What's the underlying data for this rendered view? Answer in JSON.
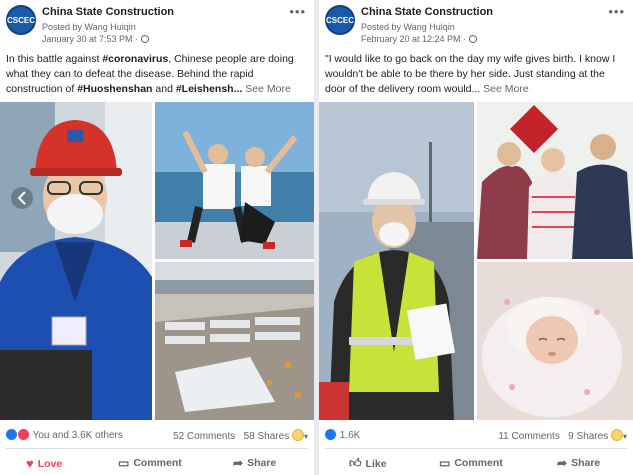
{
  "post1": {
    "page_name": "China State Construction",
    "avatar_text": "CSCEC",
    "posted_by": "Posted by Wang Huiqin",
    "date": "January 30 at 7:53 PM ·",
    "text_1": "In this battle against ",
    "tag_1": "#coronavirus",
    "text_2": ", Chinese people are doing what they can to defeat the disease. Behind the rapid construction of ",
    "tag_2": "#Huoshenshan",
    "text_3": " and ",
    "tag_3": "#Leishensh...",
    "see_more": " See More",
    "reactions": "You and 3.6K others",
    "comments": "52 Comments",
    "shares": "58 Shares",
    "btn_love": "Love",
    "btn_comment": "Comment",
    "btn_share": "Share"
  },
  "post2": {
    "page_name": "China State Construction",
    "avatar_text": "CSCEC",
    "posted_by": "Posted by Wang Huiqin",
    "date": "February 20 at 12:24 PM ·",
    "text": "\"I would like to go back on the day my wife gives birth. I know I wouldn't be able to be there by her side. Just standing at the door of the delivery room would...",
    "see_more": " See More",
    "reactions": "1.6K",
    "comments": "11 Comments",
    "shares": "9 Shares",
    "btn_like": "Like",
    "btn_comment": "Comment",
    "btn_share": "Share"
  },
  "colors": {
    "brand_blue": "#1a5aa8",
    "like_blue": "#1877f2",
    "love_red": "#f33e58",
    "meta_gray": "#606770"
  }
}
